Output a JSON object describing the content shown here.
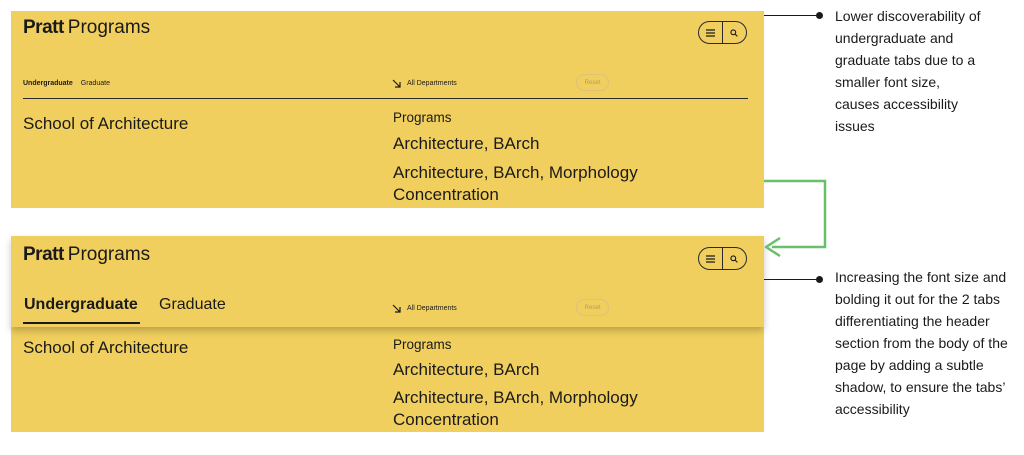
{
  "brand": {
    "logo": "Pratt",
    "title": "Programs"
  },
  "icons": {
    "menu": "menu-icon",
    "search": "search-icon",
    "departments": "arrow-down-right-icon"
  },
  "filters": {
    "tab_undergraduate": "Undergraduate",
    "tab_graduate": "Graduate",
    "departments": "All Departments",
    "reset": "Reset"
  },
  "content": {
    "school": "School of Architecture",
    "programs_label": "Programs",
    "programs": [
      "Architecture, BArch",
      "Architecture, BArch, Morphology Concentration"
    ]
  },
  "annotations": {
    "before": "Lower discoverability of undergraduate and graduate tabs due to a smaller font size, causes accessibility issues",
    "after": "Increasing the font size and bolding it out for the 2 tabs differentiating the header section from the body of the page by adding a subtle shadow, to ensure the tabs’ accessibility"
  },
  "colors": {
    "panel_bg": "#f1cf5e",
    "text": "#1a1a1a",
    "connector_arrow": "#6abf69",
    "reset_border": "#ddc27a"
  }
}
